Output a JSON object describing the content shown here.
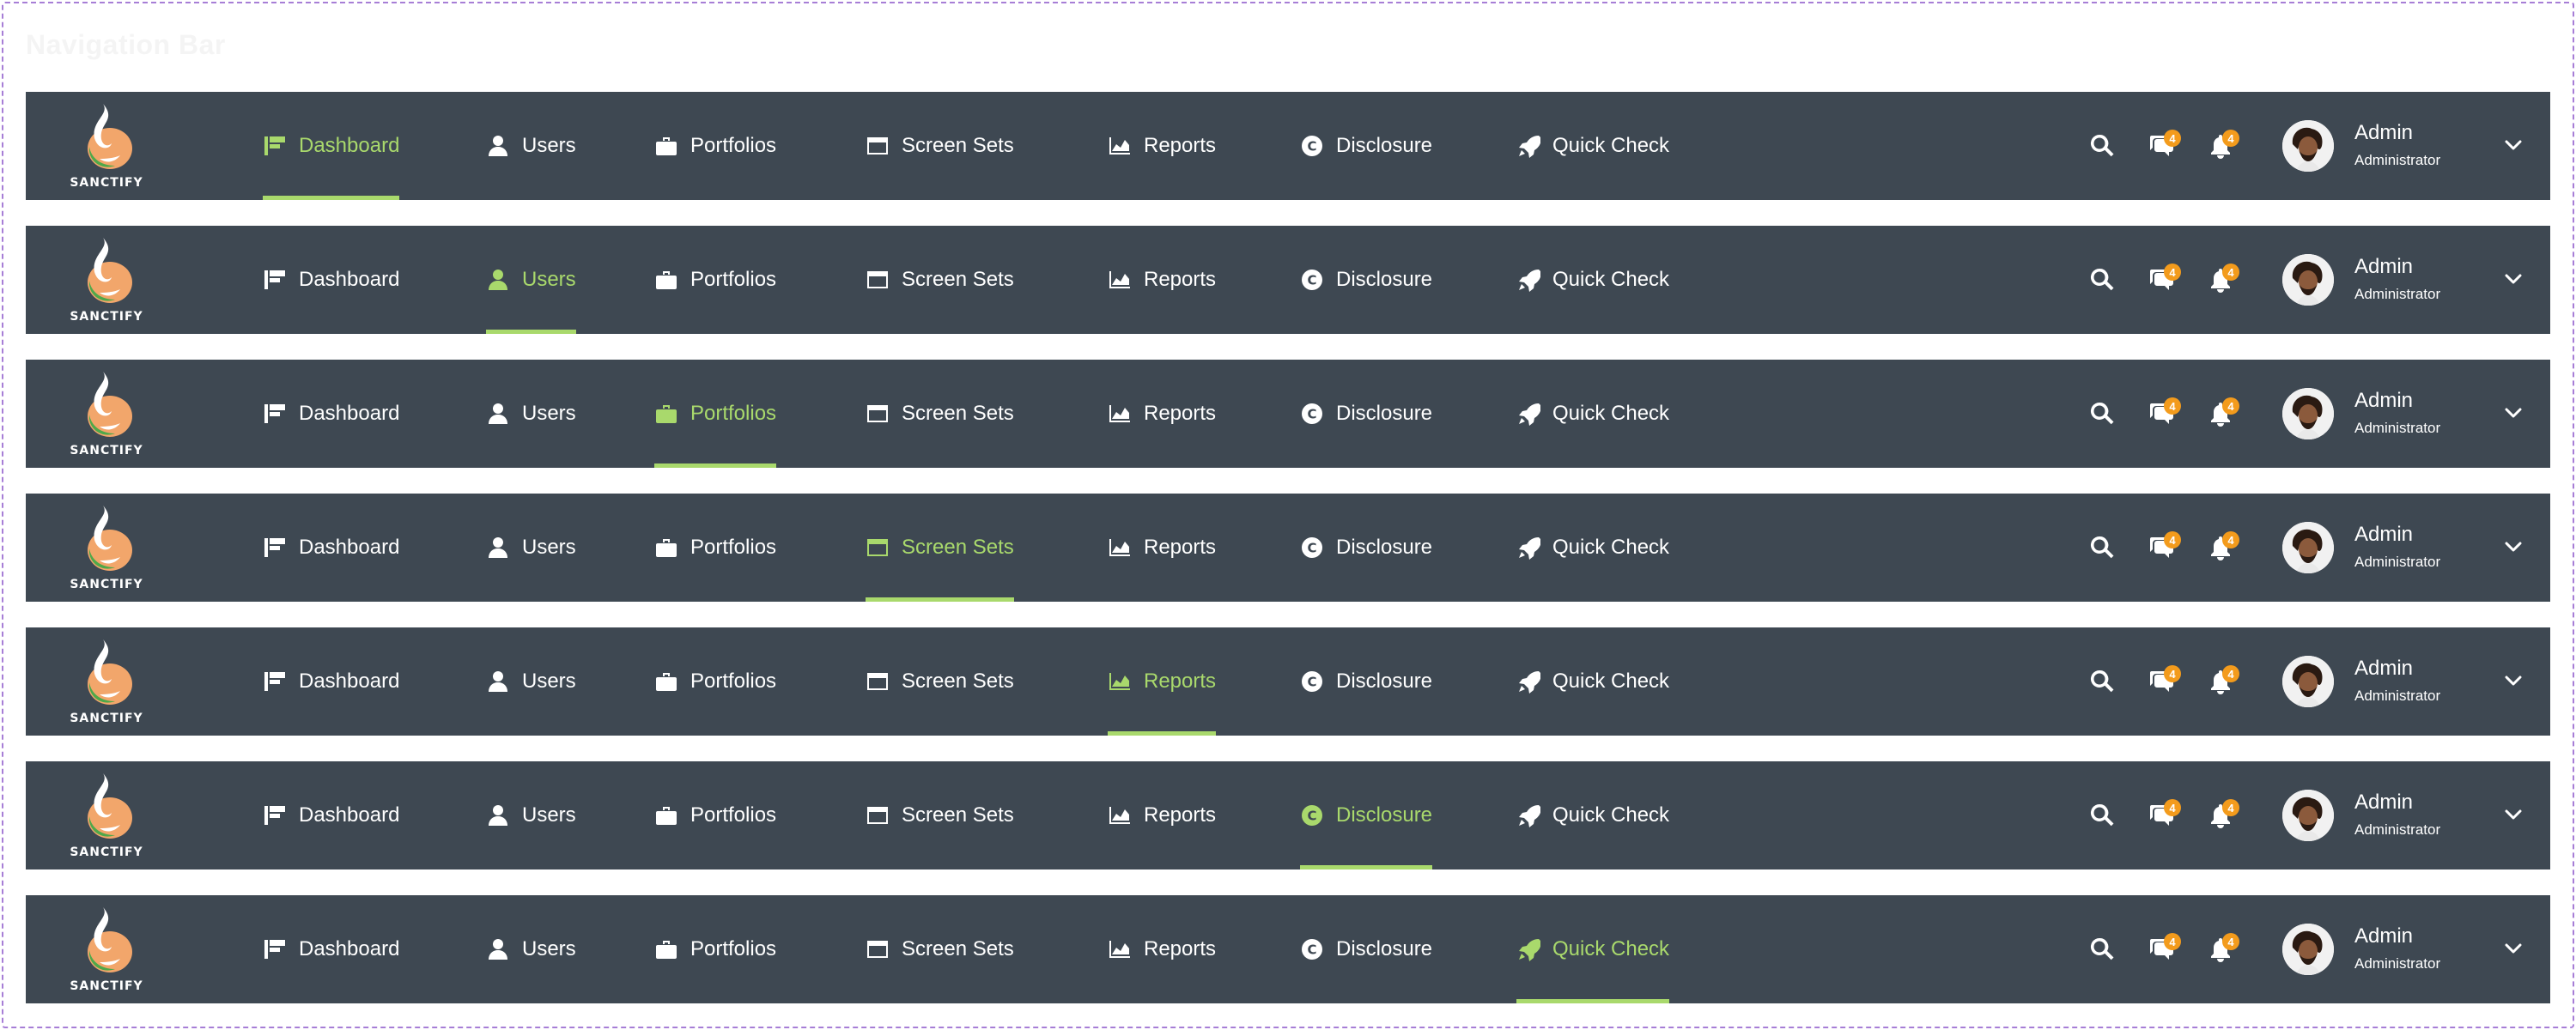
{
  "section_title": "Navigation Bar",
  "brand": {
    "name": "SANCTIFY"
  },
  "nav_items": [
    {
      "key": "dashboard",
      "label": "Dashboard",
      "icon": "dashboard-icon"
    },
    {
      "key": "users",
      "label": "Users",
      "icon": "user-icon"
    },
    {
      "key": "portfolios",
      "label": "Portfolios",
      "icon": "briefcase-icon"
    },
    {
      "key": "screen-sets",
      "label": "Screen Sets",
      "icon": "window-icon"
    },
    {
      "key": "reports",
      "label": "Reports",
      "icon": "area-chart-icon"
    },
    {
      "key": "disclosure",
      "label": "Disclosure",
      "icon": "copyright-icon"
    },
    {
      "key": "quick-check",
      "label": "Quick Check",
      "icon": "rocket-icon"
    }
  ],
  "toolbar": {
    "search_icon": "search-icon",
    "messages_icon": "chat-icon",
    "messages_badge": "4",
    "notifications_icon": "bell-icon",
    "notifications_badge": "4"
  },
  "user": {
    "name": "Admin",
    "role": "Administrator"
  },
  "variants": [
    {
      "active": "dashboard"
    },
    {
      "active": "users"
    },
    {
      "active": "portfolios"
    },
    {
      "active": "screen-sets"
    },
    {
      "active": "reports"
    },
    {
      "active": "disclosure"
    },
    {
      "active": "quick-check"
    }
  ],
  "colors": {
    "bar_background": "#3e4852",
    "active_accent": "#a9d96c",
    "badge": "#f39b1c",
    "text": "#ffffff"
  }
}
